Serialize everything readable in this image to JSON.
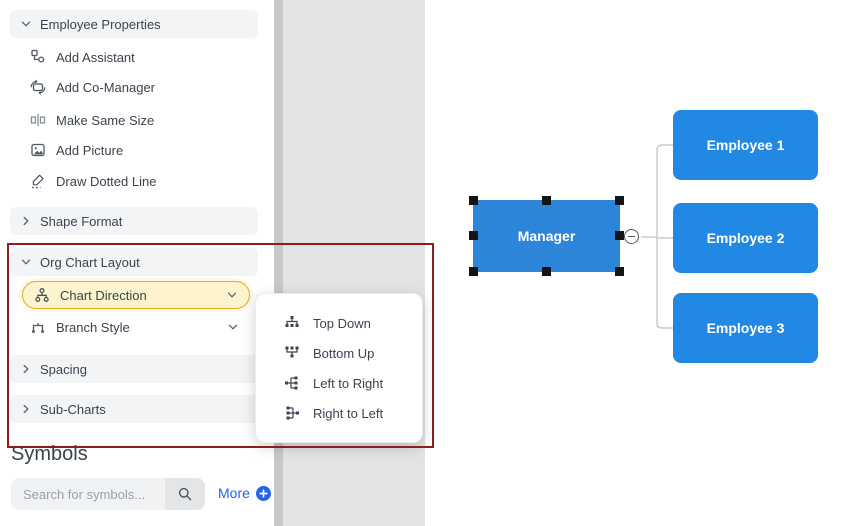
{
  "sidebar": {
    "sections": {
      "employee_properties": {
        "label": "Employee Properties",
        "collapsed": false
      },
      "shape_format": {
        "label": "Shape Format",
        "collapsed": true
      },
      "org_chart_layout": {
        "label": "Org Chart Layout",
        "collapsed": false
      },
      "spacing": {
        "label": "Spacing",
        "collapsed": true
      },
      "sub_charts": {
        "label": "Sub-Charts",
        "collapsed": true
      }
    },
    "employee_items": [
      {
        "label": "Add Assistant",
        "icon": "add-assistant-icon"
      },
      {
        "label": "Add Co-Manager",
        "icon": "add-co-manager-icon"
      },
      {
        "label": "Make Same Size",
        "icon": "make-same-size-icon"
      },
      {
        "label": "Add Picture",
        "icon": "add-picture-icon"
      },
      {
        "label": "Draw Dotted Line",
        "icon": "draw-dotted-line-icon"
      }
    ],
    "org_chart_items": [
      {
        "label": "Chart Direction",
        "icon": "chart-direction-icon",
        "highlighted": true
      },
      {
        "label": "Branch Style",
        "icon": "branch-style-icon",
        "highlighted": false
      }
    ],
    "symbols": {
      "heading": "Symbols",
      "search_placeholder": "Search for symbols...",
      "more_label": "More",
      "search_icon": "search-icon",
      "more_icon": "plus-circle-icon"
    }
  },
  "chart_direction_menu": {
    "items": [
      {
        "label": "Top Down",
        "icon": "top-down-icon"
      },
      {
        "label": "Bottom Up",
        "icon": "bottom-up-icon"
      },
      {
        "label": "Left to Right",
        "icon": "left-to-right-icon"
      },
      {
        "label": "Right to Left",
        "icon": "right-to-left-icon"
      }
    ]
  },
  "canvas": {
    "nodes": [
      {
        "label": "Manager",
        "selected": true
      },
      {
        "label": "Employee 1",
        "selected": false
      },
      {
        "label": "Employee 2",
        "selected": false
      },
      {
        "label": "Employee 3",
        "selected": false
      }
    ],
    "collapse_badge": "minus-icon"
  },
  "annotation": {
    "shape": "rectangle",
    "color": "#8F1D1D"
  },
  "colors": {
    "node_fill_manager": "#2C85D8",
    "node_fill_employee": "#2189E4",
    "highlight_bg": "#FDF3CD",
    "highlight_border": "#DFAB22",
    "section_header_bg": "#F3F4F6",
    "accent_blue": "#2563EB",
    "annotation_red": "#8F1D1D",
    "connector_gray": "#C9CBCD"
  }
}
